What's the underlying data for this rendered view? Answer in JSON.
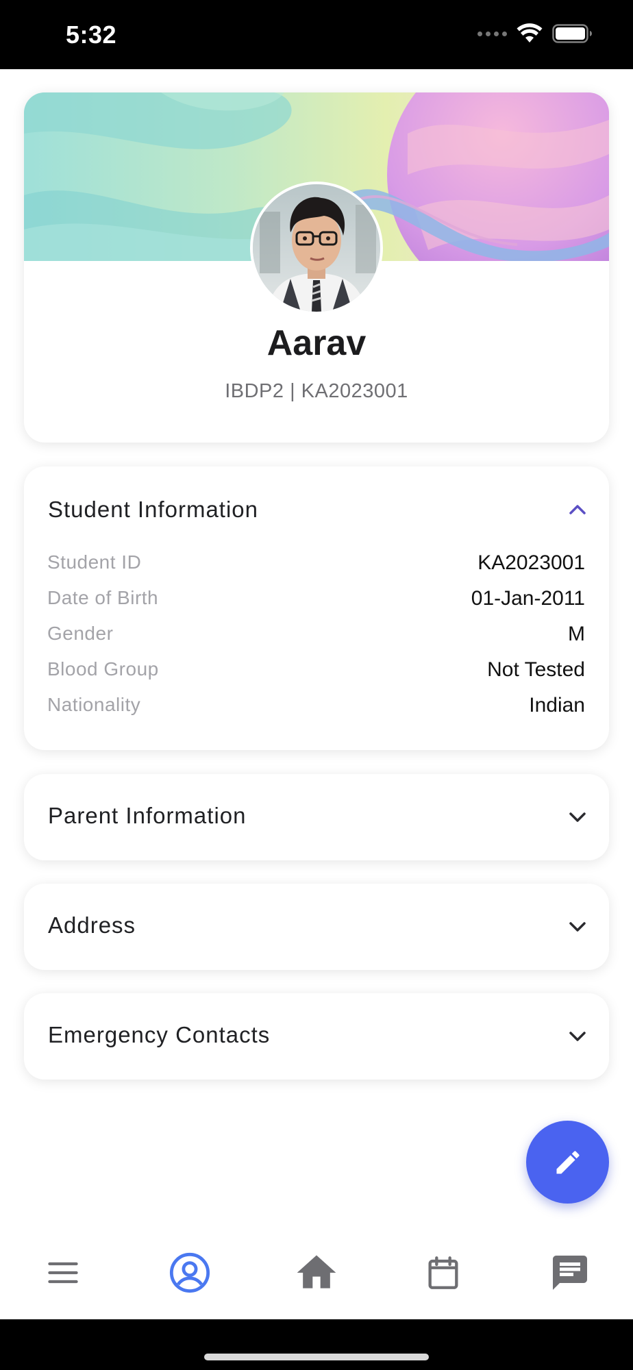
{
  "status_bar": {
    "time": "5:32"
  },
  "profile": {
    "name": "Aarav",
    "subtitle": "IBDP2 | KA2023001"
  },
  "student_info": {
    "title": "Student Information",
    "expanded": true,
    "rows": [
      {
        "label": "Student ID",
        "value": "KA2023001"
      },
      {
        "label": "Date of Birth",
        "value": "01-Jan-2011"
      },
      {
        "label": "Gender",
        "value": "M"
      },
      {
        "label": "Blood Group",
        "value": "Not Tested"
      },
      {
        "label": "Nationality",
        "value": "Indian"
      }
    ]
  },
  "sections": [
    {
      "title": "Parent Information",
      "expanded": false
    },
    {
      "title": "Address",
      "expanded": false
    },
    {
      "title": "Emergency Contacts",
      "expanded": false
    }
  ],
  "fab": {
    "icon": "pencil-icon",
    "color": "#4a63f0"
  },
  "bottom_nav": {
    "active_index": 1,
    "active_color": "#4a78f0",
    "items": [
      {
        "icon": "menu-icon"
      },
      {
        "icon": "profile-icon"
      },
      {
        "icon": "home-icon"
      },
      {
        "icon": "calendar-icon"
      },
      {
        "icon": "chat-icon"
      }
    ]
  },
  "colors": {
    "accent": "#4a63f0",
    "chevron_active": "#5b4fc4",
    "chevron": "#2a2a2e"
  }
}
